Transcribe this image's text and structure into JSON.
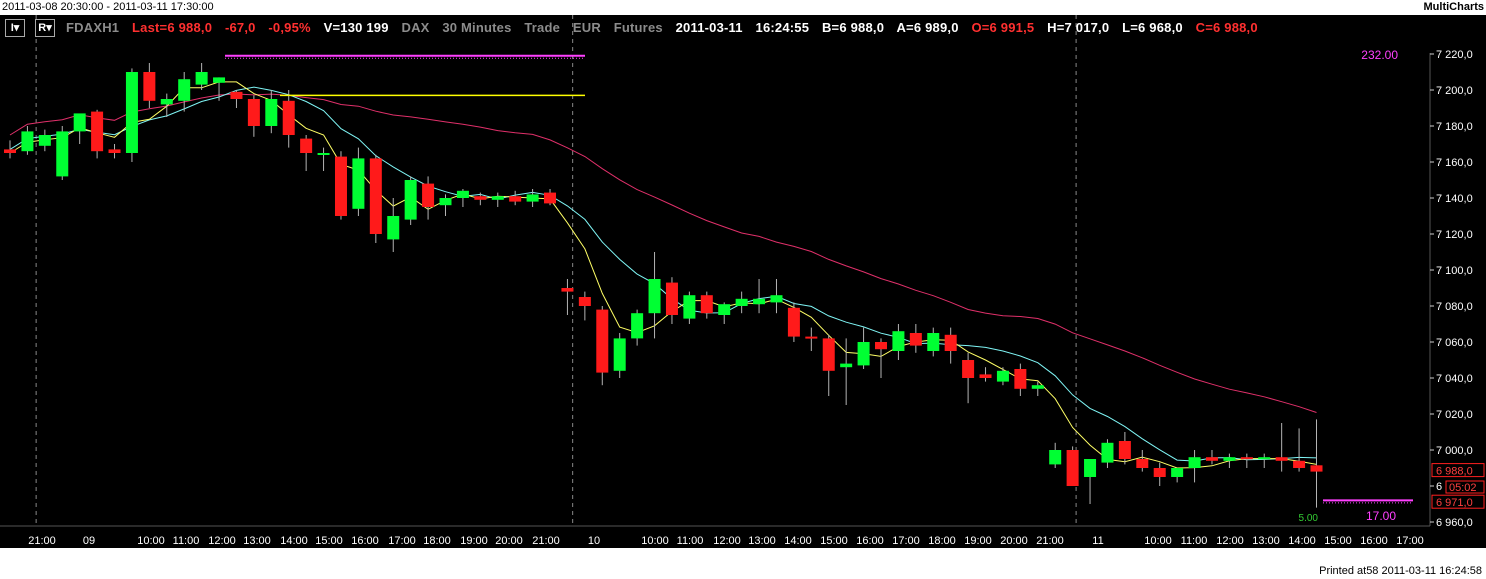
{
  "window": {
    "range_title": "2011-03-08 20:30:00 - 2011-03-11 17:30:00",
    "app_name": "MultiCharts",
    "printed": "Printed at58 2011-03-11 16:24:58"
  },
  "toolbar": {
    "btn1": "I▾",
    "btn2": "R▾"
  },
  "header": {
    "symbol": "FDAXH1",
    "last": "Last=6 988,0",
    "change": "-67,0",
    "change_pct": "-0,95%",
    "volume": "V=130 199",
    "exchange": "DAX",
    "interval": "30 Minutes",
    "data_type": "Trade",
    "currency": "EUR",
    "category": "Futures",
    "date": "2011-03-11",
    "time": "16:24:55",
    "bid": "B=6 988,0",
    "ask": "A=6 989,0",
    "open": "O=6 991,5",
    "high": "H=7 017,0",
    "low": "L=6 968,0",
    "close": "C=6 988,0"
  },
  "colors": {
    "background": "#000000",
    "up_candle": "#00ff33",
    "down_candle": "#ff1a1a",
    "wick": "#b4b4b4",
    "ma_fast": "#ffff66",
    "ma_mid": "#7ff5f5",
    "ma_slow": "#e0306a",
    "magenta": "#ff40ff",
    "yellow_line": "#ffff00",
    "axis_text": "#ffffff",
    "separator": "#888888"
  },
  "chart_data": {
    "type": "candlestick",
    "symbol": "FDAXH1",
    "interval": "30 Minutes",
    "ylim": [
      6955,
      7235
    ],
    "y_ticks": [
      "6 960,0",
      "6 980,0",
      "7 000,0",
      "7 020,0",
      "7 040,0",
      "7 060,0",
      "7 080,0",
      "7 100,0",
      "7 120,0",
      "7 140,0",
      "7 160,0",
      "7 180,0",
      "7 200,0",
      "7 220,0"
    ],
    "x_labels": [
      "21:00",
      "09",
      "10:00",
      "11:00",
      "12:00",
      "13:00",
      "14:00",
      "15:00",
      "16:00",
      "17:00",
      "18:00",
      "19:00",
      "20:00",
      "21:00",
      "10",
      "10:00",
      "11:00",
      "12:00",
      "13:00",
      "14:00",
      "15:00",
      "16:00",
      "17:00",
      "18:00",
      "19:00",
      "20:00",
      "21:00",
      "11",
      "10:00",
      "11:00",
      "12:00",
      "13:00",
      "14:00",
      "15:00",
      "16:00",
      "17:00"
    ],
    "day_separators": [
      "09",
      "10",
      "11"
    ],
    "candles": [
      {
        "o": 7167,
        "h": 7172,
        "l": 7162,
        "c": 7165
      },
      {
        "o": 7166,
        "h": 7180,
        "l": 7164,
        "c": 7177
      },
      {
        "o": 7169,
        "h": 7178,
        "l": 7166,
        "c": 7175
      },
      {
        "o": 7152,
        "h": 7180,
        "l": 7150,
        "c": 7177
      },
      {
        "o": 7177,
        "h": 7185,
        "l": 7170,
        "c": 7187
      },
      {
        "o": 7188,
        "h": 7189,
        "l": 7162,
        "c": 7166
      },
      {
        "o": 7167,
        "h": 7170,
        "l": 7162,
        "c": 7165
      },
      {
        "o": 7165,
        "h": 7212,
        "l": 7160,
        "c": 7210
      },
      {
        "o": 7210,
        "h": 7215,
        "l": 7190,
        "c": 7194
      },
      {
        "o": 7192,
        "h": 7198,
        "l": 7185,
        "c": 7195
      },
      {
        "o": 7194,
        "h": 7210,
        "l": 7188,
        "c": 7206
      },
      {
        "o": 7203,
        "h": 7215,
        "l": 7200,
        "c": 7210
      },
      {
        "o": 7204,
        "h": 7207,
        "l": 7194,
        "c": 7207
      },
      {
        "o": 7199,
        "h": 7200,
        "l": 7190,
        "c": 7195
      },
      {
        "o": 7195,
        "h": 7197,
        "l": 7174,
        "c": 7180
      },
      {
        "o": 7180,
        "h": 7200,
        "l": 7176,
        "c": 7195
      },
      {
        "o": 7194,
        "h": 7200,
        "l": 7168,
        "c": 7175
      },
      {
        "o": 7173,
        "h": 7175,
        "l": 7155,
        "c": 7165
      },
      {
        "o": 7165,
        "h": 7168,
        "l": 7155,
        "c": 7165
      },
      {
        "o": 7163,
        "h": 7166,
        "l": 7128,
        "c": 7130
      },
      {
        "o": 7134,
        "h": 7168,
        "l": 7130,
        "c": 7162
      },
      {
        "o": 7162,
        "h": 7164,
        "l": 7115,
        "c": 7120
      },
      {
        "o": 7117,
        "h": 7140,
        "l": 7110,
        "c": 7130
      },
      {
        "o": 7128,
        "h": 7152,
        "l": 7125,
        "c": 7150
      },
      {
        "o": 7148,
        "h": 7152,
        "l": 7128,
        "c": 7135
      },
      {
        "o": 7136,
        "h": 7142,
        "l": 7130,
        "c": 7140
      },
      {
        "o": 7140,
        "h": 7145,
        "l": 7135,
        "c": 7144
      },
      {
        "o": 7141,
        "h": 7143,
        "l": 7136,
        "c": 7139
      },
      {
        "o": 7139,
        "h": 7143,
        "l": 7135,
        "c": 7141
      },
      {
        "o": 7141,
        "h": 7144,
        "l": 7136,
        "c": 7138
      },
      {
        "o": 7138,
        "h": 7145,
        "l": 7135,
        "c": 7142
      },
      {
        "o": 7143,
        "h": 7145,
        "l": 7136,
        "c": 7137
      },
      {
        "o": 7090,
        "h": 7095,
        "l": 7075,
        "c": 7088
      },
      {
        "o": 7085,
        "h": 7088,
        "l": 7072,
        "c": 7080
      },
      {
        "o": 7078,
        "h": 7080,
        "l": 7036,
        "c": 7043
      },
      {
        "o": 7044,
        "h": 7065,
        "l": 7040,
        "c": 7062
      },
      {
        "o": 7062,
        "h": 7078,
        "l": 7058,
        "c": 7076
      },
      {
        "o": 7076,
        "h": 7110,
        "l": 7062,
        "c": 7095
      },
      {
        "o": 7093,
        "h": 7096,
        "l": 7070,
        "c": 7075
      },
      {
        "o": 7073,
        "h": 7088,
        "l": 7070,
        "c": 7086
      },
      {
        "o": 7086,
        "h": 7088,
        "l": 7073,
        "c": 7076
      },
      {
        "o": 7075,
        "h": 7082,
        "l": 7070,
        "c": 7081
      },
      {
        "o": 7080,
        "h": 7088,
        "l": 7076,
        "c": 7084
      },
      {
        "o": 7081,
        "h": 7095,
        "l": 7076,
        "c": 7084
      },
      {
        "o": 7082,
        "h": 7095,
        "l": 7076,
        "c": 7086
      },
      {
        "o": 7079,
        "h": 7082,
        "l": 7060,
        "c": 7063
      },
      {
        "o": 7063,
        "h": 7068,
        "l": 7055,
        "c": 7062
      },
      {
        "o": 7062,
        "h": 7064,
        "l": 7030,
        "c": 7044
      },
      {
        "o": 7046,
        "h": 7062,
        "l": 7025,
        "c": 7048
      },
      {
        "o": 7047,
        "h": 7068,
        "l": 7045,
        "c": 7060
      },
      {
        "o": 7060,
        "h": 7062,
        "l": 7040,
        "c": 7056
      },
      {
        "o": 7055,
        "h": 7070,
        "l": 7050,
        "c": 7066
      },
      {
        "o": 7065,
        "h": 7070,
        "l": 7054,
        "c": 7058
      },
      {
        "o": 7055,
        "h": 7068,
        "l": 7052,
        "c": 7065
      },
      {
        "o": 7064,
        "h": 7068,
        "l": 7048,
        "c": 7055
      },
      {
        "o": 7050,
        "h": 7054,
        "l": 7026,
        "c": 7040
      },
      {
        "o": 7042,
        "h": 7046,
        "l": 7038,
        "c": 7040
      },
      {
        "o": 7038,
        "h": 7046,
        "l": 7036,
        "c": 7044
      },
      {
        "o": 7045,
        "h": 7048,
        "l": 7030,
        "c": 7034
      },
      {
        "o": 7034,
        "h": 7038,
        "l": 7030,
        "c": 7036
      },
      {
        "o": 6992,
        "h": 7004,
        "l": 6990,
        "c": 7000
      },
      {
        "o": 7000,
        "h": 7002,
        "l": 6980,
        "c": 6980
      },
      {
        "o": 6985,
        "h": 6995,
        "l": 6970,
        "c": 6995
      },
      {
        "o": 6993,
        "h": 7006,
        "l": 6990,
        "c": 7004
      },
      {
        "o": 7005,
        "h": 7010,
        "l": 6992,
        "c": 6995
      },
      {
        "o": 6995,
        "h": 7000,
        "l": 6988,
        "c": 6990
      },
      {
        "o": 6990,
        "h": 6993,
        "l": 6980,
        "c": 6985
      },
      {
        "o": 6985,
        "h": 6990,
        "l": 6982,
        "c": 6990
      },
      {
        "o": 6990,
        "h": 7000,
        "l": 6982,
        "c": 6996
      },
      {
        "o": 6996,
        "h": 7000,
        "l": 6992,
        "c": 6994
      },
      {
        "o": 6994,
        "h": 6998,
        "l": 6990,
        "c": 6996
      },
      {
        "o": 6996,
        "h": 6998,
        "l": 6990,
        "c": 6995
      },
      {
        "o": 6995,
        "h": 6998,
        "l": 6990,
        "c": 6996
      },
      {
        "o": 6996,
        "h": 7015,
        "l": 6988,
        "c": 6994
      },
      {
        "o": 6994,
        "h": 7012,
        "l": 6988,
        "c": 6990
      },
      {
        "o": 6991.5,
        "h": 7017,
        "l": 6968,
        "c": 6988
      }
    ],
    "annotations": {
      "magenta_top_label": "232.00",
      "magenta_bottom_label": "17.00",
      "green_label": "5.00",
      "magenta_top_level": 7219,
      "magenta_bottom_level": 6972,
      "yellow_level": 7197
    },
    "price_tags": {
      "last": "6 988,0",
      "countdown": "05:02",
      "low": "6 971,0"
    }
  }
}
